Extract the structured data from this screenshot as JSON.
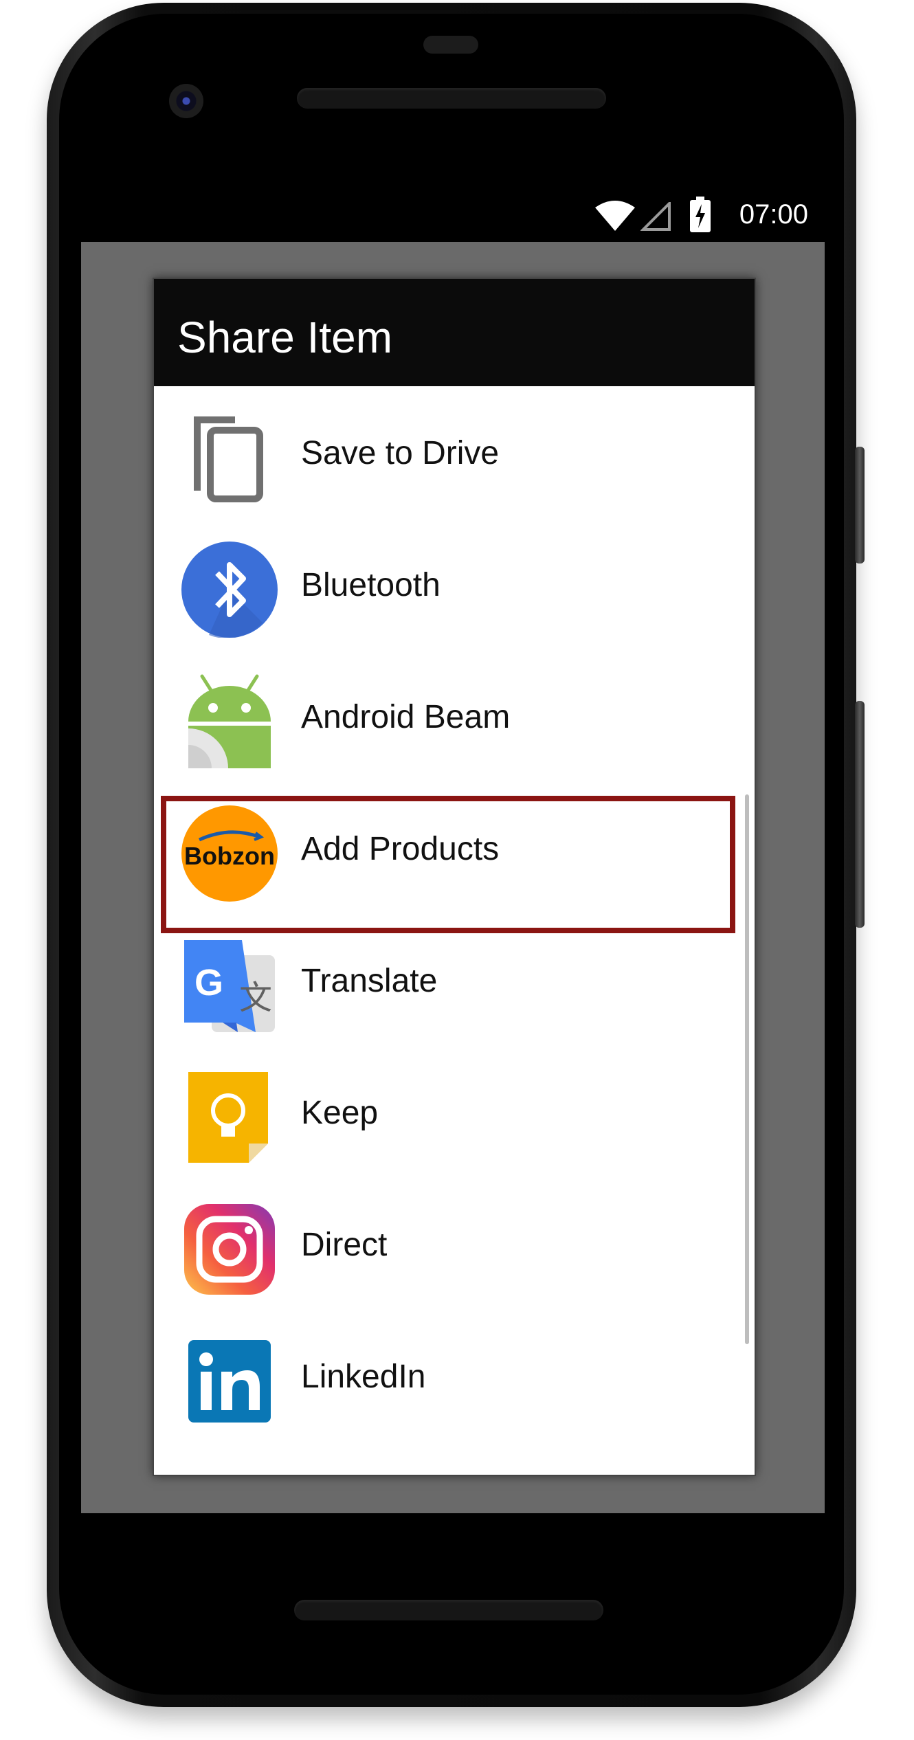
{
  "status_bar": {
    "time": "07:00"
  },
  "dialog": {
    "title": "Share Item",
    "items": [
      {
        "label": "Save to Drive",
        "icon": "copy-icon"
      },
      {
        "label": "Bluetooth",
        "icon": "bluetooth-icon"
      },
      {
        "label": "Android Beam",
        "icon": "android-beam-icon"
      },
      {
        "label": "Add Products",
        "icon": "bobzon-icon",
        "icon_text": "Bobzon",
        "highlighted": true
      },
      {
        "label": "Translate",
        "icon": "google-translate-icon"
      },
      {
        "label": "Keep",
        "icon": "keep-icon"
      },
      {
        "label": "Direct",
        "icon": "instagram-icon"
      },
      {
        "label": "LinkedIn",
        "icon": "linkedin-icon"
      }
    ]
  },
  "colors": {
    "highlight": "#8b1512",
    "bluetooth": "#3b6fd8",
    "bobzon": "#ff9800",
    "linkedin": "#0a77b5",
    "keep": "#f6b400"
  }
}
